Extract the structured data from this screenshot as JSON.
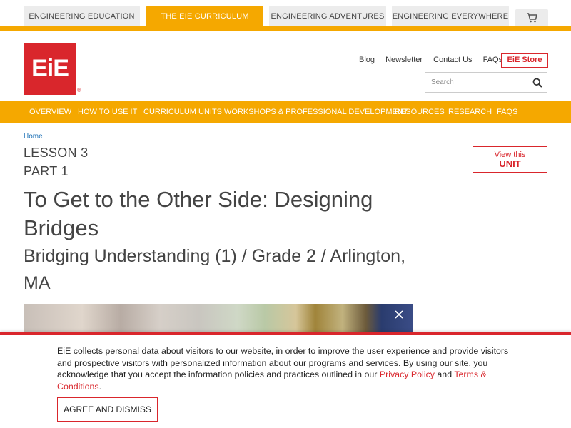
{
  "top_tabs": [
    "Engineering Education",
    "The EiE Curriculum",
    "Engineering Adventures",
    "Engineering Everywhere"
  ],
  "brand": {
    "logo_text": "EiE",
    "registered": "®",
    "primary_color": "#d9262c",
    "accent_color": "#f5a800"
  },
  "util_links": [
    "Blog",
    "Newsletter",
    "Contact Us",
    "FAQs"
  ],
  "store_label": "EiE Store",
  "search": {
    "placeholder": "Search"
  },
  "main_nav": [
    "Overview",
    "How to Use It",
    "Curriculum Units",
    "Workshops & Professional Development",
    "Resources",
    "Research",
    "FAQs"
  ],
  "breadcrumb": "Home",
  "lesson": "LESSON 3",
  "part": "PART 1",
  "title": "To Get to the Other Side: Designing Bridges",
  "subtitle": "Bridging Understanding (1) / Grade 2 / Arlington, MA",
  "view_unit": {
    "line1": "View this",
    "line2": "UNIT"
  },
  "cookie": {
    "text_before": "EiE collects personal data about visitors to our website, in order to improve the user experience and provide visitors and prospective visitors with personalized information about our programs and services. By using our site, you acknowledge that you accept the information policies and practices outlined in our ",
    "privacy_link": "Privacy Policy",
    "and": " and ",
    "terms_link": "Terms & Conditions",
    "end": ".",
    "button": "Agree and Dismiss"
  },
  "icons": {
    "cart": "cart-icon",
    "search": "search-icon",
    "close": "close-icon"
  }
}
